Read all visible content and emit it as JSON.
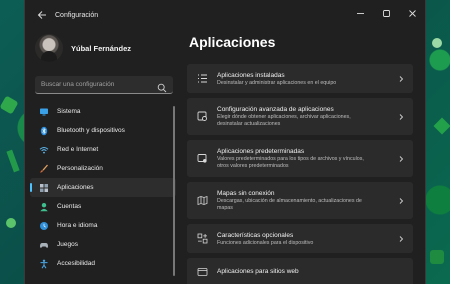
{
  "window": {
    "title": "Configuración"
  },
  "profile": {
    "name": "Yúbal Fernández"
  },
  "search": {
    "placeholder": "Buscar una configuración"
  },
  "sidebar": {
    "items": [
      {
        "label": "Sistema",
        "icon": "monitor-icon",
        "active": false
      },
      {
        "label": "Bluetooth y dispositivos",
        "icon": "bluetooth-icon",
        "active": false
      },
      {
        "label": "Red e Internet",
        "icon": "wifi-icon",
        "active": false
      },
      {
        "label": "Personalización",
        "icon": "brush-icon",
        "active": false
      },
      {
        "label": "Aplicaciones",
        "icon": "apps-icon",
        "active": true
      },
      {
        "label": "Cuentas",
        "icon": "person-icon",
        "active": false
      },
      {
        "label": "Hora e idioma",
        "icon": "globe-clock-icon",
        "active": false
      },
      {
        "label": "Juegos",
        "icon": "gamepad-icon",
        "active": false
      },
      {
        "label": "Accesibilidad",
        "icon": "accessibility-icon",
        "active": false
      }
    ]
  },
  "main": {
    "title": "Aplicaciones",
    "cards": [
      {
        "title": "Aplicaciones instaladas",
        "desc": "Desinstalar y administrar aplicaciones en el equipo",
        "desc2": "",
        "icon": "list-icon"
      },
      {
        "title": "Configuración avanzada de aplicaciones",
        "desc": "Elegir dónde obtener aplicaciones, archivar aplicaciones,",
        "desc2": "desinstalar actualizaciones",
        "icon": "app-settings-icon"
      },
      {
        "title": "Aplicaciones predeterminadas",
        "desc": "Valores predeterminados para los tipos de archivos y vínculos,",
        "desc2": "otros valores predeterminados",
        "icon": "default-apps-icon"
      },
      {
        "title": "Mapas sin conexión",
        "desc": "Descargas, ubicación de almacenamiento, actualizaciones de",
        "desc2": "mapas",
        "icon": "map-icon"
      },
      {
        "title": "Características opcionales",
        "desc": "Funciones adicionales para el dispositivo",
        "desc2": "",
        "icon": "optional-features-icon"
      },
      {
        "title": "Aplicaciones para sitios web",
        "desc": "",
        "desc2": "",
        "icon": "web-apps-icon"
      }
    ]
  },
  "colors": {
    "accent": "#4cc2ff",
    "window_bg": "#202020",
    "card_bg": "#2b2b2b"
  }
}
